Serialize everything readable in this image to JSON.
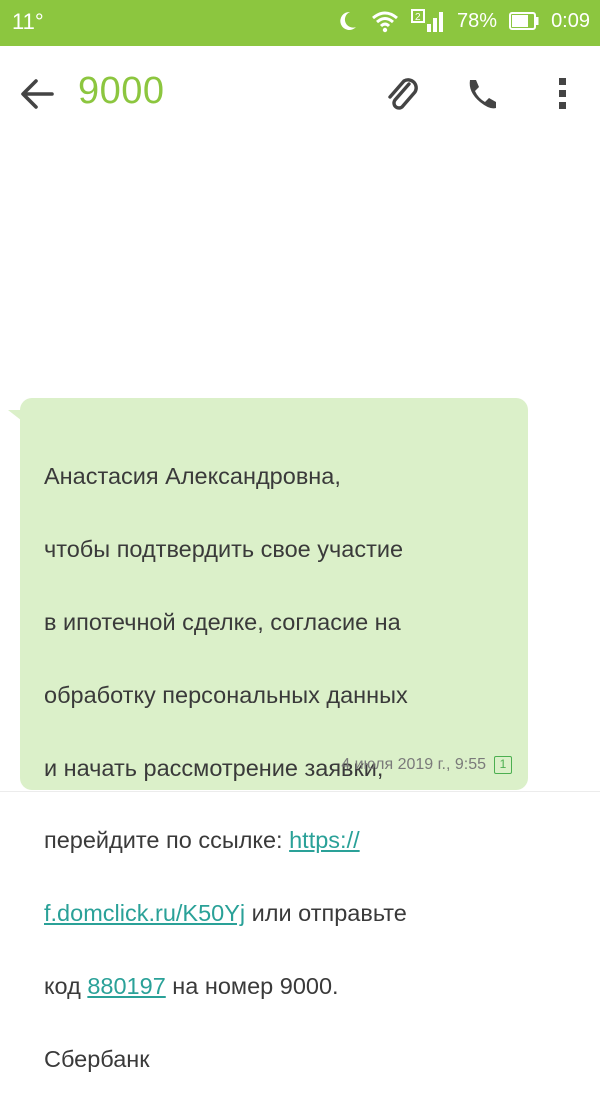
{
  "status_bar": {
    "temperature": "11°",
    "battery_percent": "78%",
    "time": "0:09",
    "sim_badge": "2"
  },
  "header": {
    "contact": "9000"
  },
  "message": {
    "text_lines": [
      "Анастасия Александровна,",
      "чтобы подтвердить свое участие",
      "в ипотечной сделке, согласие на",
      "обработку персональных данных",
      "и начать рассмотрение заявки,"
    ],
    "line6_prefix": "перейдите по ссылке: ",
    "link_part1": "https://",
    "link_part2": "f.domclick.ru/K50Yj",
    "line7_suffix": " или отправьте",
    "line8_prefix": "код ",
    "code": "880197",
    "line8_suffix": " на номер 9000.",
    "line9": "Сбербанк",
    "timestamp": "4 июля 2019 г., 9:55",
    "sim_slot": "1"
  },
  "colors": {
    "accent": "#8cc63f",
    "bubble": "#dbf0c9",
    "link": "#2aa198"
  }
}
